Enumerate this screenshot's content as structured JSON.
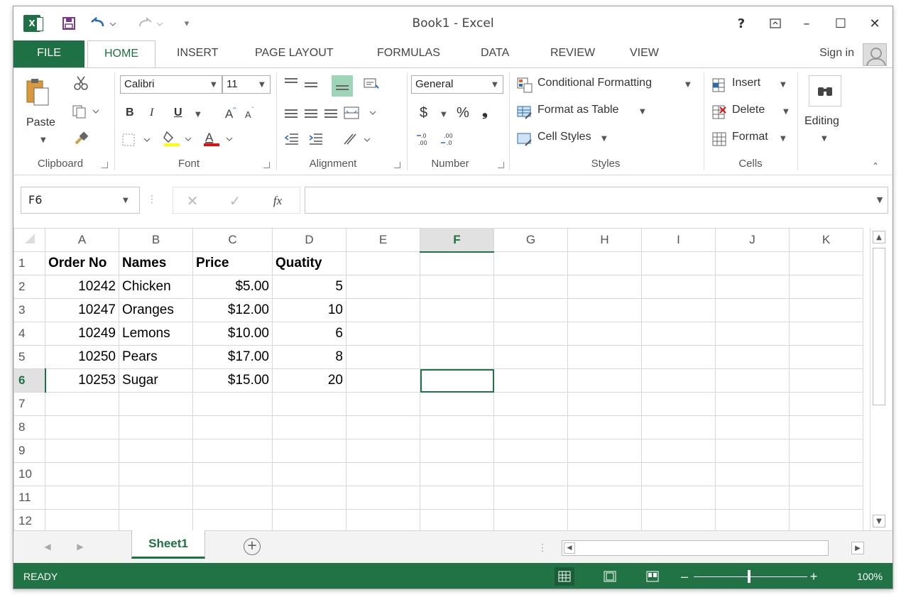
{
  "window": {
    "title": "Book1 - Excel"
  },
  "quick_access": {
    "save_icon": "save-icon",
    "undo_icon": "undo-icon",
    "redo_icon": "redo-icon"
  },
  "window_controls": {
    "help": "?",
    "restore_ribbon": "ribbon-display-icon",
    "minimize": "–",
    "maximize": "☐",
    "close": "✕"
  },
  "tabs": [
    "FILE",
    "HOME",
    "INSERT",
    "PAGE LAYOUT",
    "FORMULAS",
    "DATA",
    "REVIEW",
    "VIEW"
  ],
  "sign_in": "Sign in",
  "ribbon": {
    "clipboard": {
      "label": "Clipboard",
      "paste": "Paste"
    },
    "font": {
      "label": "Font",
      "name": "Calibri",
      "size": "11",
      "bold": "B",
      "italic": "I",
      "underline": "U"
    },
    "alignment": {
      "label": "Alignment"
    },
    "number": {
      "label": "Number",
      "format": "General",
      "currency": "$",
      "percent": "%",
      "comma": "❟"
    },
    "styles": {
      "label": "Styles",
      "conditional": "Conditional Formatting",
      "format_table": "Format as Table",
      "cell_styles": "Cell Styles"
    },
    "cells": {
      "label": "Cells",
      "insert": "Insert",
      "delete": "Delete",
      "format": "Format"
    },
    "editing": {
      "label": "Editing"
    }
  },
  "formula_bar": {
    "name_box": "F6",
    "fx": "fx",
    "value": ""
  },
  "columns": [
    "A",
    "B",
    "C",
    "D",
    "E",
    "F",
    "G",
    "H",
    "I",
    "J",
    "K"
  ],
  "rows": [
    {
      "n": "1",
      "cells": [
        "Order No",
        "Names",
        "Price",
        "Quatity",
        "",
        "",
        "",
        "",
        "",
        "",
        ""
      ]
    },
    {
      "n": "2",
      "cells": [
        "10242",
        "Chicken",
        "$5.00",
        "5",
        "",
        "",
        "",
        "",
        "",
        "",
        ""
      ]
    },
    {
      "n": "3",
      "cells": [
        "10247",
        "Oranges",
        "$12.00",
        "10",
        "",
        "",
        "",
        "",
        "",
        "",
        ""
      ]
    },
    {
      "n": "4",
      "cells": [
        "10249",
        "Lemons",
        "$10.00",
        "6",
        "",
        "",
        "",
        "",
        "",
        "",
        ""
      ]
    },
    {
      "n": "5",
      "cells": [
        "10250",
        "Pears",
        "$17.00",
        "8",
        "",
        "",
        "",
        "",
        "",
        "",
        ""
      ]
    },
    {
      "n": "6",
      "cells": [
        "10253",
        "Sugar",
        "$15.00",
        "20",
        "",
        "",
        "",
        "",
        "",
        "",
        ""
      ]
    },
    {
      "n": "7",
      "cells": [
        "",
        "",
        "",
        "",
        "",
        "",
        "",
        "",
        "",
        "",
        ""
      ]
    },
    {
      "n": "8",
      "cells": [
        "",
        "",
        "",
        "",
        "",
        "",
        "",
        "",
        "",
        "",
        ""
      ]
    },
    {
      "n": "9",
      "cells": [
        "",
        "",
        "",
        "",
        "",
        "",
        "",
        "",
        "",
        "",
        ""
      ]
    },
    {
      "n": "10",
      "cells": [
        "",
        "",
        "",
        "",
        "",
        "",
        "",
        "",
        "",
        "",
        ""
      ]
    },
    {
      "n": "11",
      "cells": [
        "",
        "",
        "",
        "",
        "",
        "",
        "",
        "",
        "",
        "",
        ""
      ]
    },
    {
      "n": "12",
      "cells": [
        "",
        "",
        "",
        "",
        "",
        "",
        "",
        "",
        "",
        "",
        ""
      ]
    }
  ],
  "selected_cell": {
    "col": "F",
    "row": "6"
  },
  "sheets": [
    "Sheet1"
  ],
  "status": {
    "mode": "READY",
    "zoom": "100%"
  },
  "colors": {
    "accent": "#217346",
    "header_selected": "#e1e1e1"
  }
}
